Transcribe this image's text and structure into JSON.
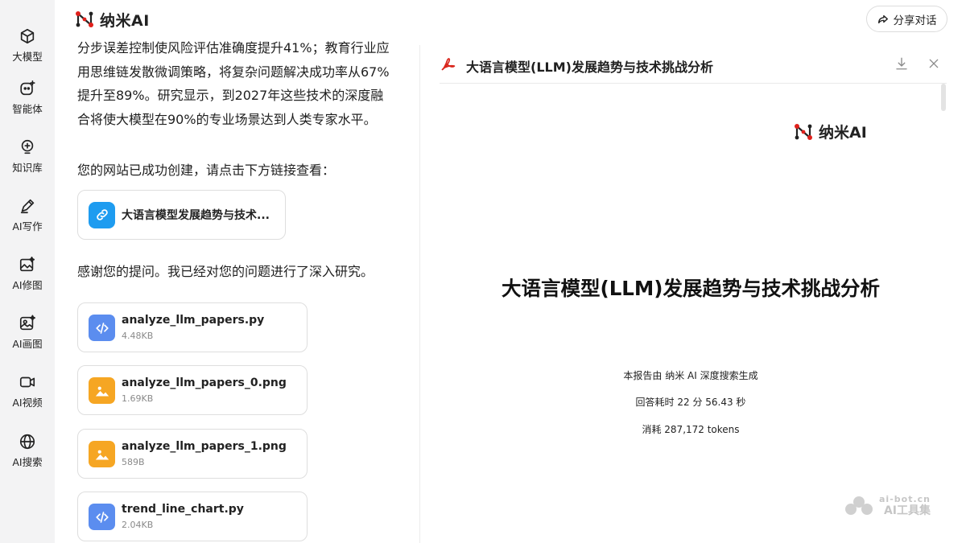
{
  "brand": {
    "name": "纳米AI"
  },
  "header": {
    "share_label": "分享对话"
  },
  "sidebar": {
    "items": [
      {
        "label": "大模型",
        "icon": "cube-icon"
      },
      {
        "label": "智能体",
        "icon": "agent-icon"
      },
      {
        "label": "知识库",
        "icon": "knowledge-icon"
      },
      {
        "label": "AI写作",
        "icon": "pen-icon"
      },
      {
        "label": "AI修图",
        "icon": "image-edit-icon"
      },
      {
        "label": "AI画图",
        "icon": "paint-icon"
      },
      {
        "label": "AI视频",
        "icon": "video-icon"
      },
      {
        "label": "AI搜索",
        "icon": "globe-icon"
      }
    ]
  },
  "chat": {
    "para1": "分步误差控制使风险评估准确度提升41%；教育行业应用思维链发散微调策略，将复杂问题解决成功率从67%提升至89%。研究显示，到2027年这些技术的深度融合将使大模型在90%的专业场景达到人类专家水平。",
    "para2": "您的网站已成功创建，请点击下方链接查看：",
    "link_title": "大语言模型发展趋势与技术...",
    "para3": "感谢您的提问。我已经对您的问题进行了深入研究。",
    "files": [
      {
        "name": "analyze_llm_papers.py",
        "size": "4.48KB",
        "type": "code"
      },
      {
        "name": "analyze_llm_papers_0.png",
        "size": "1.69KB",
        "type": "image"
      },
      {
        "name": "analyze_llm_papers_1.png",
        "size": "589B",
        "type": "image"
      },
      {
        "name": "trend_line_chart.py",
        "size": "2.04KB",
        "type": "code"
      }
    ]
  },
  "preview": {
    "title": "大语言模型(LLM)发展趋势与技术挑战分析",
    "doc_title": "大语言模型(LLM)发展趋势与技术挑战分析",
    "meta": {
      "generated": "本报告由 纳米 AI 深度搜索生成",
      "time": "回答耗时 22 分 56.43 秒",
      "tokens": "消耗 287,172 tokens"
    }
  },
  "watermark": {
    "domain": "ai-bot.cn",
    "name": "AI工具集"
  },
  "colors": {
    "sidebar_bg": "#f3f3f4",
    "link_icon_bg": "#1e9cf0",
    "code_icon_bg": "#5b8def",
    "image_icon_bg": "#f6a623",
    "pdf_red": "#d9261c"
  }
}
